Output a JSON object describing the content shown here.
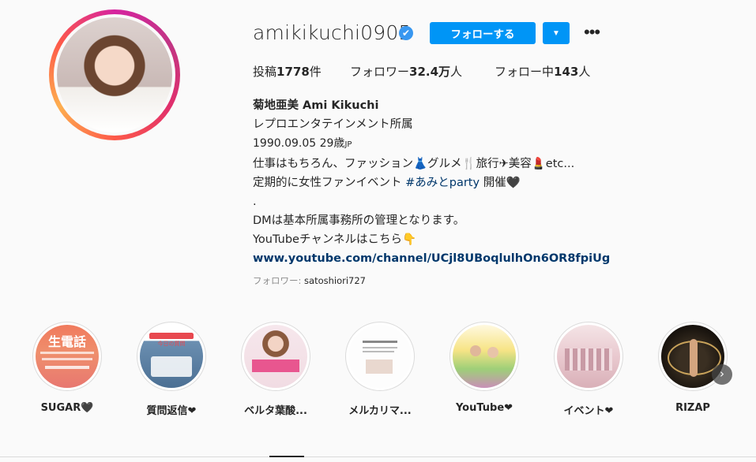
{
  "profile": {
    "username": "amikikuchi0905",
    "verified_mark": "✔",
    "follow_label": "フォローする",
    "dropdown_label": "▼",
    "more_label": "•••"
  },
  "stats": {
    "posts_label": "投稿",
    "posts_value": "1778",
    "posts_suffix": "件",
    "followers_label": "フォロワー",
    "followers_value": "32.4万",
    "followers_suffix": "人",
    "following_label": "フォロー中",
    "following_value": "143",
    "following_suffix": "人"
  },
  "bio": {
    "name": "菊地亜美 Ami Kikuchi",
    "line1": "レプロエンタテインメント所属",
    "line2": "1990.09.05 29歳",
    "line2_flag": "JP",
    "line3": "仕事はもちろん、ファッション👗グルメ🍴旅行✈美容💄etc...",
    "line4_pre": "定期的に女性ファンイベント",
    "line4_tag": "#あみとparty",
    "line4_post": "開催🖤",
    "line5": ".",
    "line6": "DMは基本所属事務所の管理となります。",
    "line7": "YouTubeチャンネルはこちら👇",
    "link": "www.youtube.com/channel/UCjl8UBoqlulhOn6OR8fpiUg"
  },
  "followed_by": {
    "label": "フォロワー:",
    "user": "satoshiori727"
  },
  "highlights": [
    {
      "label": "SUGAR🖤",
      "text": "生電話"
    },
    {
      "label": "質問返信❤",
      "text": "今日の質問"
    },
    {
      "label": "ベルタ葉酸...",
      "text": ""
    },
    {
      "label": "メルカリマ...",
      "text": ""
    },
    {
      "label": "YouTube❤",
      "text": ""
    },
    {
      "label": "イベント❤",
      "text": ""
    },
    {
      "label": "RIZAP",
      "text": ""
    }
  ],
  "colors": {
    "follow_blue": "#0095f6",
    "link_blue": "#00376b",
    "muted": "#8e8e8e"
  }
}
